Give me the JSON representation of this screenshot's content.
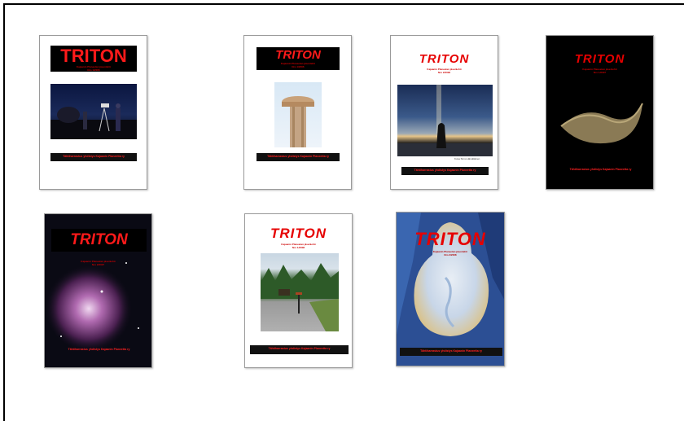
{
  "covers": [
    {
      "logo": "TRITON",
      "subtitle": "Kajaanin Planeetan jäsenlehti",
      "issue": "Nro 1/2006",
      "footer": "Tähtiharrastus yhdistys Kajaanin Planeetta ry"
    },
    {
      "logo": "TRITON",
      "subtitle": "Kajaanin Planeetan jäsenlehti",
      "issue": "Nro 1/2006",
      "footer": "Tähtiharrastus yhdistys Kajaanin Planeetta ry"
    },
    {
      "logo": "TRITON",
      "subtitle": "Kajaanin Planeetan jäsenlehti",
      "issue": "Nro 2/2006",
      "footer": "Tähtiharrastus yhdistys Kajaanin Planeetta ry",
      "credit": "Kuva Simo Hämäläinen"
    },
    {
      "logo": "TRITON",
      "subtitle": "Kajaanin Planeetan jäsenlehti",
      "issue": "Nro 1/2007",
      "footer": "Tähtiharrastus yhdistys Kajaanin Planeetta ry"
    },
    {
      "logo": "TRITON",
      "subtitle": "Kajaanin Planeetan jäsenlehti",
      "issue": "Nro 2/2007",
      "footer": "Tähtiharrastus yhdistys Kajaanin Planeetta ry"
    },
    {
      "logo": "TRITON",
      "subtitle": "Kajaanin Planeetan jäsenlehti",
      "issue": "Nro 1/2008",
      "footer": "Tähtiharrastus yhdistys Kajaanin Planeetta ry"
    },
    {
      "logo": "TRITON",
      "subtitle": "Kajaanin Planeetan jäsenlehti",
      "issue": "Nro 2/2008",
      "footer": "Tähtiharrastus yhdistys Kajaanin Planeetta ry"
    }
  ],
  "colors": {
    "logo_red": "#e60000",
    "footer_bg": "#111111",
    "cover_border": "#9a9a9a"
  }
}
